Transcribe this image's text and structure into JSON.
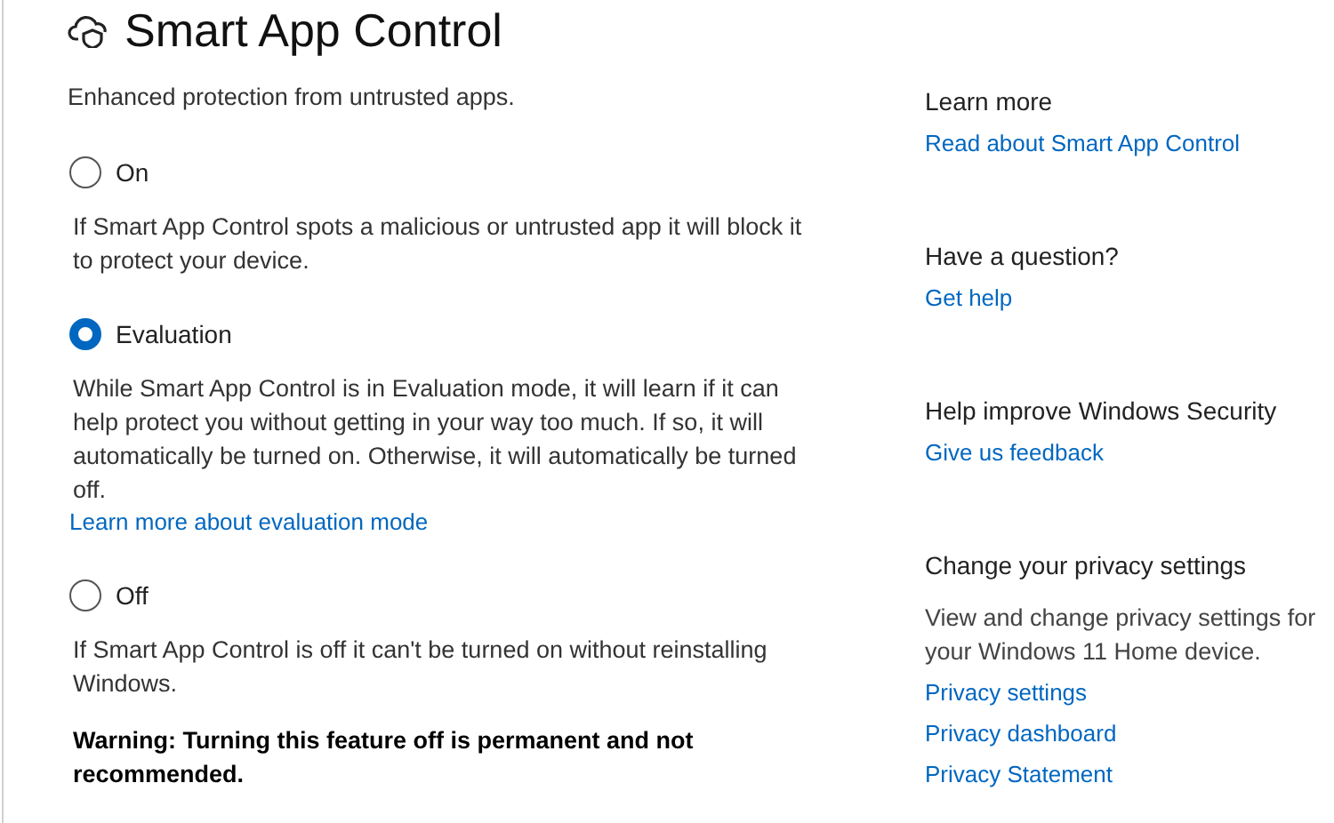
{
  "header": {
    "title": "Smart App Control"
  },
  "subtitle": "Enhanced protection from untrusted apps.",
  "options": [
    {
      "label": "On",
      "selected": false,
      "description": "If Smart App Control spots a malicious or untrusted app it will block it to protect your device."
    },
    {
      "label": "Evaluation",
      "selected": true,
      "description": "While Smart App Control is in Evaluation mode, it will learn if it can help protect you without getting in your way too much. If so, it will automatically be turned on. Otherwise, it will automatically be turned off.",
      "link": "Learn more about evaluation mode"
    },
    {
      "label": "Off",
      "selected": false,
      "description": "If Smart App Control is off it can't be turned on without reinstalling Windows.",
      "warning": "Warning: Turning this feature off is permanent and not recommended."
    }
  ],
  "sidebar": [
    {
      "heading": "Learn more",
      "links": [
        "Read about Smart App Control"
      ]
    },
    {
      "heading": "Have a question?",
      "links": [
        "Get help"
      ]
    },
    {
      "heading": "Help improve Windows Security",
      "links": [
        "Give us feedback"
      ]
    },
    {
      "heading": "Change your privacy settings",
      "text": "View and change privacy settings for your Windows 11 Home device.",
      "links": [
        "Privacy settings",
        "Privacy dashboard",
        "Privacy Statement"
      ]
    }
  ]
}
